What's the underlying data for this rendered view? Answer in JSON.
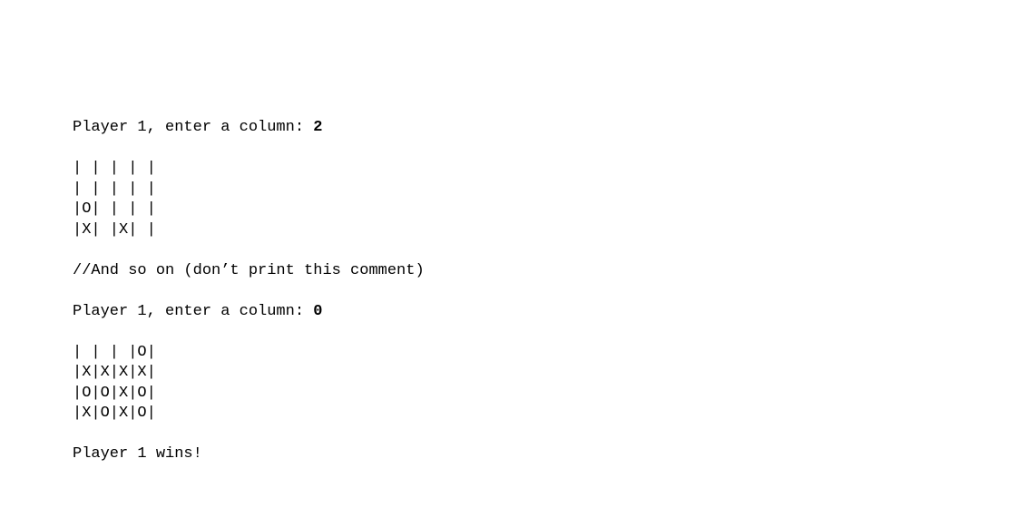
{
  "prompt1_text": "Player 1, enter a column: ",
  "prompt1_input": "2",
  "board1": {
    "row0": "| | | | |",
    "row1": "| | | | |",
    "row2": "|O| | | |",
    "row3": "|X| |X| |"
  },
  "comment_line": "//And so on (don’t print this comment)",
  "prompt2_text": "Player 1, enter a column: ",
  "prompt2_input": "0",
  "board2": {
    "row0": "| | | |O|",
    "row1": "|X|X|X|X|",
    "row2": "|O|O|X|O|",
    "row3": "|X|O|X|O|"
  },
  "result_line": "Player 1 wins!"
}
